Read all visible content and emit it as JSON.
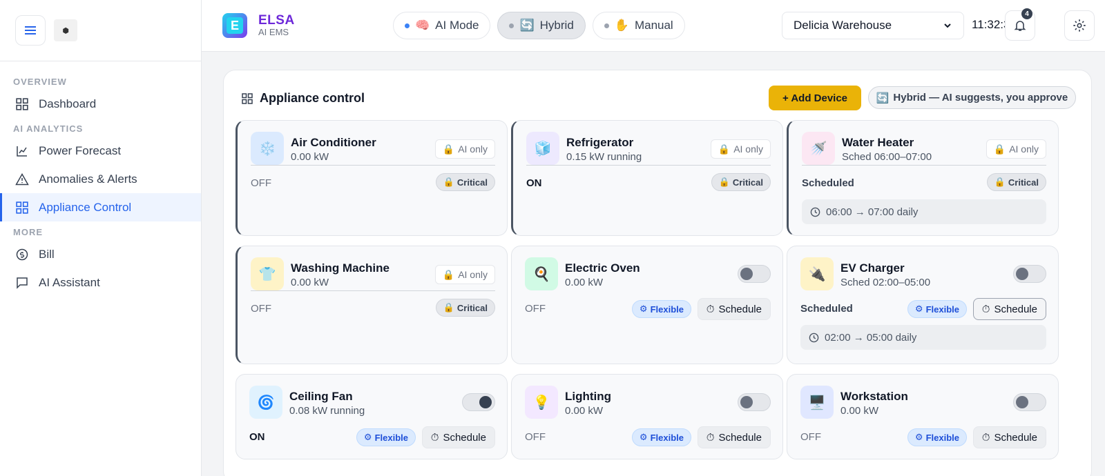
{
  "sidebar": {
    "logo_glyph": "⬢",
    "sections": [
      {
        "title": "OVERVIEW",
        "items": [
          {
            "label": "Dashboard",
            "icon": "grid-icon"
          }
        ]
      },
      {
        "title": "AI ANALYTICS",
        "items": [
          {
            "label": "Power Forecast",
            "icon": "chart-line-icon"
          },
          {
            "label": "Anomalies & Alerts",
            "icon": "warning-triangle-icon"
          },
          {
            "label": "Appliance Control",
            "icon": "grid-icon",
            "active": true
          }
        ]
      },
      {
        "title": "MORE",
        "items": [
          {
            "label": "Bill",
            "icon": "currency-icon"
          },
          {
            "label": "AI Assistant",
            "icon": "chat-icon"
          }
        ]
      }
    ]
  },
  "header": {
    "brand_name": "ELSA",
    "brand_sub": "AI EMS",
    "brand_letter": "E",
    "modes": [
      {
        "label": "AI Mode",
        "emoji": "🧠",
        "dot_color": "#3b82f6"
      },
      {
        "label": "Hybrid",
        "emoji": "🔄",
        "dot_color": "#9ca3af",
        "active": true
      },
      {
        "label": "Manual",
        "emoji": "✋",
        "dot_color": "#9ca3af"
      }
    ],
    "site": "Delicia Warehouse",
    "clock": "11:32:32",
    "notification_count": "4"
  },
  "panel": {
    "title": "Appliance control",
    "add_button": "+ Add Device",
    "mode_pill": "Hybrid — AI suggests, you approve",
    "mode_pill_emoji": "🔄"
  },
  "labels": {
    "ai_only": "AI only",
    "critical": "Critical",
    "flexible": "Flexible",
    "schedule": "Schedule",
    "lock_emoji": "🔒",
    "flex_glyph": "⚙",
    "timer_glyph": "⏱"
  },
  "devices": [
    {
      "name": "Air Conditioner",
      "sub": "0.00 kW",
      "status": "OFF",
      "icon": "❄️",
      "bg": "#dbeafe",
      "type": "locked"
    },
    {
      "name": "Refrigerator",
      "sub": "0.15 kW running",
      "status": "ON",
      "icon": "🧊",
      "bg": "#ede9fe",
      "type": "locked"
    },
    {
      "name": "Water Heater",
      "sub": "Sched 06:00–07:00",
      "status": "Scheduled",
      "icon": "🚿",
      "bg": "#fce7f3",
      "type": "locked",
      "time": "06:00 → 07:00 daily"
    },
    {
      "name": "Washing Machine",
      "sub": "0.00 kW",
      "status": "OFF",
      "icon": "👕",
      "bg": "#fef3c7",
      "type": "locked"
    },
    {
      "name": "Electric Oven",
      "sub": "0.00 kW",
      "status": "OFF",
      "icon": "🍳",
      "bg": "#d1fae5",
      "type": "flex",
      "on": false
    },
    {
      "name": "EV Charger",
      "sub": "Sched 02:00–05:00",
      "status": "Scheduled",
      "icon": "🔌",
      "bg": "#fef3c7",
      "type": "flex",
      "on": false,
      "time": "02:00 → 05:00 daily"
    },
    {
      "name": "Ceiling Fan",
      "sub": "0.08 kW running",
      "status": "ON",
      "icon": "🌀",
      "bg": "#e0f2fe",
      "type": "flex",
      "on": true
    },
    {
      "name": "Lighting",
      "sub": "0.00 kW",
      "status": "OFF",
      "icon": "💡",
      "bg": "#f3e8ff",
      "type": "flex",
      "on": false
    },
    {
      "name": "Workstation",
      "sub": "0.00 kW",
      "status": "OFF",
      "icon": "🖥️",
      "bg": "#e0e7ff",
      "type": "flex",
      "on": false
    }
  ]
}
